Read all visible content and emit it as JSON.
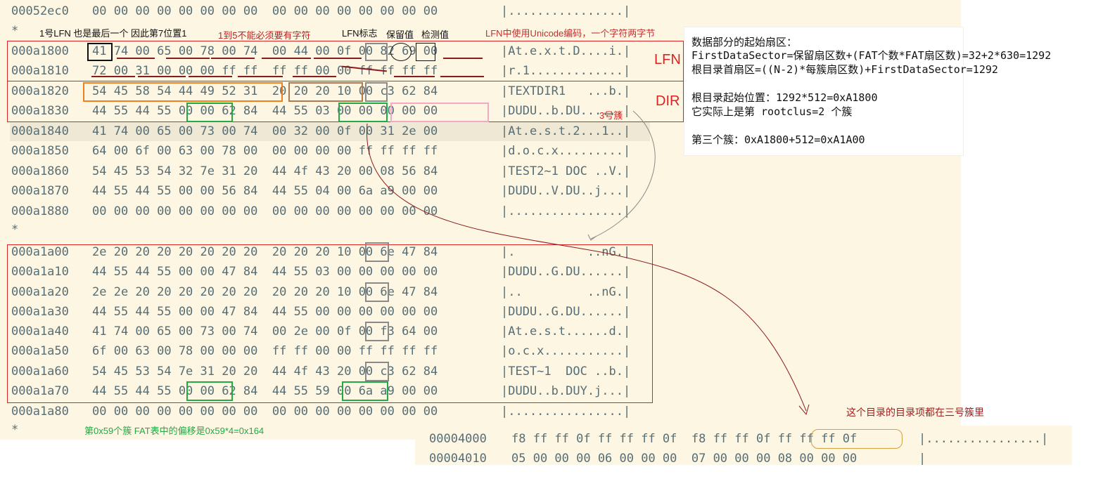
{
  "hex_dump": {
    "rows": [
      {
        "offset": "00052ec0",
        "hex": "00 00 00 00 00 00 00 00  00 00 00 00 00 00 00 00",
        "ascii": "|................|"
      },
      {
        "star": "*"
      },
      {
        "offset": "000a1800",
        "hex": "41 74 00 65 00 78 00 74  00 44 00 0f 00 82 69 00",
        "ascii": "|At.e.x.t.D....i.|"
      },
      {
        "offset": "000a1810",
        "hex": "72 00 31 00 00 00 ff ff  ff ff 00 00 ff ff ff ff",
        "ascii": "|r.1.............|"
      },
      {
        "offset": "000a1820",
        "hex": "54 45 58 54 44 49 52 31  20 20 20 10 00 c3 62 84",
        "ascii": "|TEXTDIR1   ...b.|"
      },
      {
        "offset": "000a1830",
        "hex": "44 55 44 55 00 00 62 84  44 55 03 00 00 00 00 00",
        "ascii": "|DUDU..b.DU......|"
      },
      {
        "offset": "000a1840",
        "hex": "41 74 00 65 00 73 00 74  00 32 00 0f 00 31 2e 00",
        "ascii": "|At.e.s.t.2...1..|"
      },
      {
        "offset": "000a1850",
        "hex": "64 00 6f 00 63 00 78 00  00 00 00 00 ff ff ff ff",
        "ascii": "|d.o.c.x.........|"
      },
      {
        "offset": "000a1860",
        "hex": "54 45 53 54 32 7e 31 20  44 4f 43 20 00 08 56 84",
        "ascii": "|TEST2~1 DOC ..V.|"
      },
      {
        "offset": "000a1870",
        "hex": "44 55 44 55 00 00 56 84  44 55 04 00 6a a9 00 00",
        "ascii": "|DUDU..V.DU..j...|"
      },
      {
        "offset": "000a1880",
        "hex": "00 00 00 00 00 00 00 00  00 00 00 00 00 00 00 00",
        "ascii": "|................|"
      },
      {
        "star": "*"
      },
      {
        "offset": "000a1a00",
        "hex": "2e 20 20 20 20 20 20 20  20 20 20 10 00 6e 47 84",
        "ascii": "|.          ..nG.|"
      },
      {
        "offset": "000a1a10",
        "hex": "44 55 44 55 00 00 47 84  44 55 03 00 00 00 00 00",
        "ascii": "|DUDU..G.DU......|"
      },
      {
        "offset": "000a1a20",
        "hex": "2e 2e 20 20 20 20 20 20  20 20 20 10 00 6e 47 84",
        "ascii": "|..         ..nG.|"
      },
      {
        "offset": "000a1a30",
        "hex": "44 55 44 55 00 00 47 84  44 55 00 00 00 00 00 00",
        "ascii": "|DUDU..G.DU......|"
      },
      {
        "offset": "000a1a40",
        "hex": "41 74 00 65 00 73 00 74  00 2e 00 0f 00 f3 64 00",
        "ascii": "|At.e.s.t......d.|"
      },
      {
        "offset": "000a1a50",
        "hex": "6f 00 63 00 78 00 00 00  ff ff 00 00 ff ff ff ff",
        "ascii": "|o.c.x...........|"
      },
      {
        "offset": "000a1a60",
        "hex": "54 45 53 54 7e 31 20 20  44 4f 43 20 00 c3 62 84",
        "ascii": "|TEST~1  DOC ..b.|"
      },
      {
        "offset": "000a1a70",
        "hex": "44 55 44 55 00 00 62 84  44 55 59 00 6a a9 00 00",
        "ascii": "|DUDU..b.DUY.j...|"
      },
      {
        "offset": "000a1a80",
        "hex": "00 00 00 00 00 00 00 00  00 00 00 00 00 00 00 00",
        "ascii": "|................|"
      },
      {
        "star": "*"
      }
    ]
  },
  "fat_dump": {
    "rows": [
      {
        "offset": "00004000",
        "hex": "f8 ff ff 0f ff ff ff 0f  f8 ff ff 0f ff ff ff 0f",
        "ascii": "|................|"
      },
      {
        "offset": "00004010",
        "hex": "05 00 00 00 06 00 00 00  07 00 00 00 08 00 00 00",
        "ascii": "|"
      }
    ]
  },
  "annotations": {
    "lfn_seq": "1号LFN 也是最后一个 因此第7位置1",
    "chars_1_to_5": "1到5不能必须要有字符",
    "lfn_flag": "LFN标志",
    "reserved": "保留值",
    "checksum": "检测值",
    "unicode": "LFN中使用Unicode编码，一个字符两字节",
    "lfn_label": "LFN",
    "dir_label": "DIR",
    "cluster3": "3号簇",
    "cluster_note": "这个目录的目录项都在三号簇里",
    "fat_offset": "第0x59个簇 FAT表中的偏移是0x59*4=0x164"
  },
  "notes_panel": {
    "lines": [
      "数据部分的起始扇区：",
      "FirstDataSector=保留扇区数+(FAT个数*FAT扇区数)=32+2*630=1292",
      "根目录首扇区=((N-2)*每簇扇区数)+FirstDataSector=1292",
      "",
      "根目录起始位置：1292*512=0xA1800",
      "它实际上是第 rootclus=2 个簇",
      "",
      "第三个簇：0xA1800+512=0xA1A00"
    ]
  },
  "colors": {
    "background": "#fdf6e3",
    "text": "#586e75",
    "red": "#d22222",
    "dark_red": "#8b1a1a",
    "orange": "#f08020",
    "green": "#22aa44",
    "gray": "#8a8a8a",
    "pink": "#f4a8c8"
  }
}
